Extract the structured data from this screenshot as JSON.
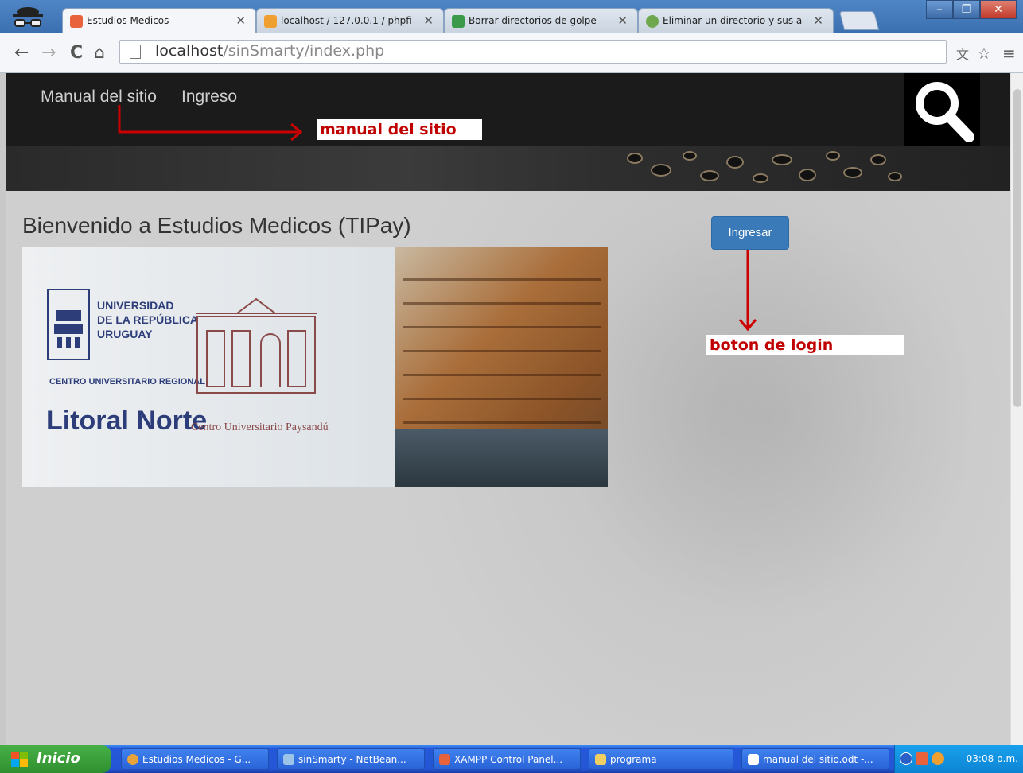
{
  "browser": {
    "tabs": [
      {
        "title": "Estudios Medicos",
        "active": true
      },
      {
        "title": "localhost / 127.0.0.1 / phpfi",
        "active": false
      },
      {
        "title": "Borrar directorios de golpe - ",
        "active": false
      },
      {
        "title": "Eliminar un directorio y sus a",
        "active": false
      }
    ],
    "url_host": "localhost",
    "url_path": "/sinSmarty/index.php",
    "icons": {
      "back": "back-arrow-icon",
      "forward": "forward-arrow-icon",
      "reload": "reload-icon",
      "home": "home-icon",
      "star": "star-icon",
      "menu": "menu-icon",
      "translate": "translate-icon"
    }
  },
  "site": {
    "nav": {
      "manual": "Manual del sitio",
      "login": "Ingreso"
    },
    "welcome": "Bienvenido a Estudios Medicos (TIPay)",
    "login_button": "Ingresar",
    "logo": {
      "line1": "UNIVERSIDAD",
      "line2": "DE LA REPÚBLICA",
      "line3": "URUGUAY",
      "centro": "CENTRO UNIVERSITARIO REGIONAL",
      "region": "Litoral Norte",
      "subtitle": "Centro Universitario Paysandú"
    }
  },
  "annotations": {
    "manual": "manual del sitio",
    "login": "boton de login",
    "color": "#cc0000"
  },
  "taskbar": {
    "start": "Inicio",
    "tasks": [
      "Estudios Medicos - G...",
      "sinSmarty - NetBean...",
      "XAMPP Control Panel...",
      "programa",
      "manual del sitio.odt -..."
    ],
    "clock": "03:08 p.m."
  }
}
